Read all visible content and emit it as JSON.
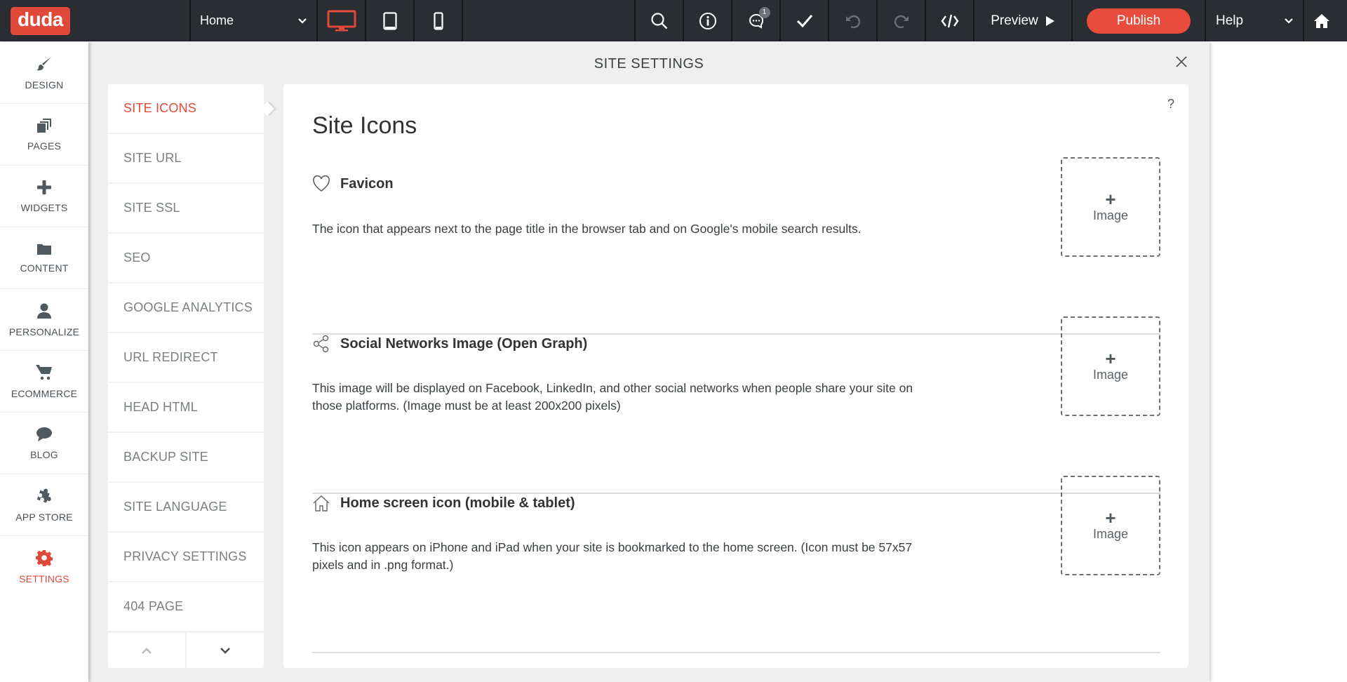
{
  "topbar": {
    "logo": "duda",
    "page_select": "Home",
    "device_icons": [
      "desktop-icon",
      "tablet-icon",
      "mobile-icon"
    ],
    "tool_icons": [
      "search-icon",
      "info-icon",
      "comments-icon",
      "check-icon",
      "undo-icon",
      "redo-icon",
      "code-icon"
    ],
    "comments_badge": "1",
    "preview_label": "Preview",
    "publish_label": "Publish",
    "help_label": "Help",
    "accent_color": "#e74c3c"
  },
  "sidebar": {
    "items": [
      {
        "label": "DESIGN",
        "icon": "brush-icon"
      },
      {
        "label": "PAGES",
        "icon": "pages-icon"
      },
      {
        "label": "WIDGETS",
        "icon": "plus-icon"
      },
      {
        "label": "CONTENT",
        "icon": "folder-icon"
      },
      {
        "label": "PERSONALIZE",
        "icon": "user-icon"
      },
      {
        "label": "ECOMMERCE",
        "icon": "cart-icon"
      },
      {
        "label": "BLOG",
        "icon": "speech-bubble-icon"
      },
      {
        "label": "APP STORE",
        "icon": "puzzle-icon"
      },
      {
        "label": "SETTINGS",
        "icon": "gear-icon",
        "active": true
      }
    ]
  },
  "panel": {
    "title": "SITE SETTINGS",
    "nav": [
      {
        "label": "SITE ICONS",
        "active": true
      },
      {
        "label": "SITE URL"
      },
      {
        "label": "SITE SSL"
      },
      {
        "label": "SEO"
      },
      {
        "label": "GOOGLE ANALYTICS"
      },
      {
        "label": "URL REDIRECT"
      },
      {
        "label": "HEAD HTML"
      },
      {
        "label": "BACKUP SITE"
      },
      {
        "label": "SITE LANGUAGE"
      },
      {
        "label": "PRIVACY SETTINGS"
      },
      {
        "label": "404 PAGE"
      }
    ],
    "help": "?",
    "content": {
      "title": "Site Icons",
      "sections": [
        {
          "name": "Favicon",
          "icon": "heart-icon",
          "description": "The icon that appears next to the page title in the browser tab and on Google's mobile search results.",
          "upload_plus": "+",
          "upload_label": "Image"
        },
        {
          "name": "Social Networks Image (Open Graph)",
          "icon": "share-icon",
          "description": "This image will be displayed on Facebook, LinkedIn, and other social networks when people share your site on those platforms. (Image must be at least 200x200 pixels)",
          "upload_plus": "+",
          "upload_label": "Image"
        },
        {
          "name": "Home screen icon (mobile & tablet)",
          "icon": "house-outline-icon",
          "description": "This icon appears on iPhone and iPad when your site is bookmarked to the home screen. (Icon must be 57x57 pixels and in .png format.)",
          "upload_plus": "+",
          "upload_label": "Image"
        }
      ]
    }
  }
}
